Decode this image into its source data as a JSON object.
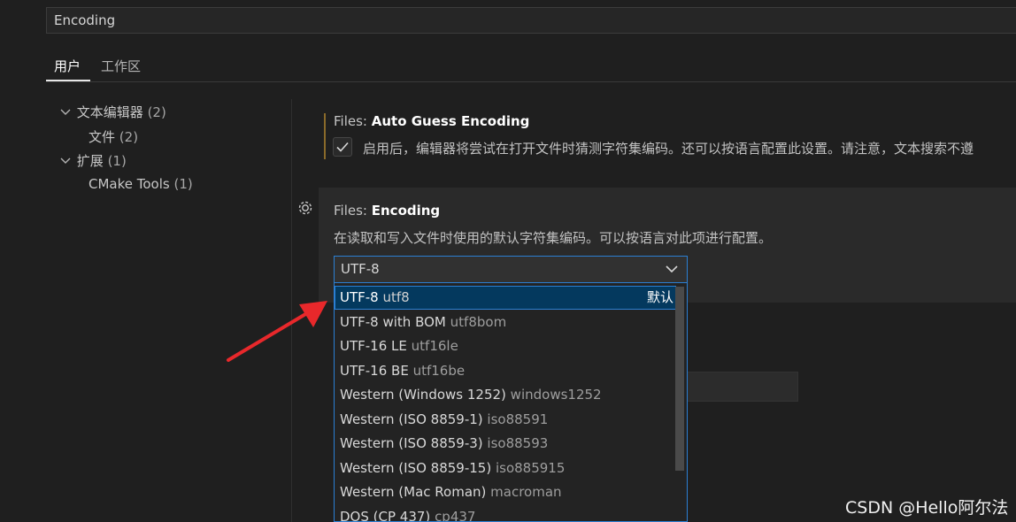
{
  "search": {
    "value": "Encoding"
  },
  "tabs": [
    {
      "label": "用户"
    },
    {
      "label": "工作区"
    }
  ],
  "toc": [
    {
      "label": "文本编辑器",
      "count": "(2)"
    },
    {
      "label": "文件",
      "count": "(2)"
    },
    {
      "label": "扩展",
      "count": "(1)"
    },
    {
      "label": "CMake Tools",
      "count": "(1)"
    }
  ],
  "setting1": {
    "category": "Files: ",
    "name": "Auto Guess Encoding",
    "checked": true,
    "description": "启用后，编辑器将尝试在打开文件时猜测字符集编码。还可以按语言配置此设置。请注意，文本搜索不遵"
  },
  "setting2": {
    "category": "Files: ",
    "name": "Encoding",
    "description": "在读取和写入文件时使用的默认字符集编码。可以按语言对此项进行配置。",
    "selected_value": "UTF-8"
  },
  "dropdown": {
    "default_label": "默认",
    "options": [
      {
        "label": "UTF-8",
        "id": "utf8"
      },
      {
        "label": "UTF-8 with BOM",
        "id": "utf8bom"
      },
      {
        "label": "UTF-16 LE",
        "id": "utf16le"
      },
      {
        "label": "UTF-16 BE",
        "id": "utf16be"
      },
      {
        "label": "Western (Windows 1252)",
        "id": "windows1252"
      },
      {
        "label": "Western (ISO 8859-1)",
        "id": "iso88591"
      },
      {
        "label": "Western (ISO 8859-3)",
        "id": "iso88593"
      },
      {
        "label": "Western (ISO 8859-15)",
        "id": "iso885915"
      },
      {
        "label": "Western (Mac Roman)",
        "id": "macroman"
      },
      {
        "label": "DOS (CP 437)",
        "id": "cp437"
      }
    ]
  },
  "watermark": "CSDN @Hello阿尔法",
  "colors": {
    "accent": "#2b7fd3",
    "selected_bg": "#04395e",
    "annotation_arrow": "#e8282b",
    "modified_bar": "#8a6a2a"
  }
}
